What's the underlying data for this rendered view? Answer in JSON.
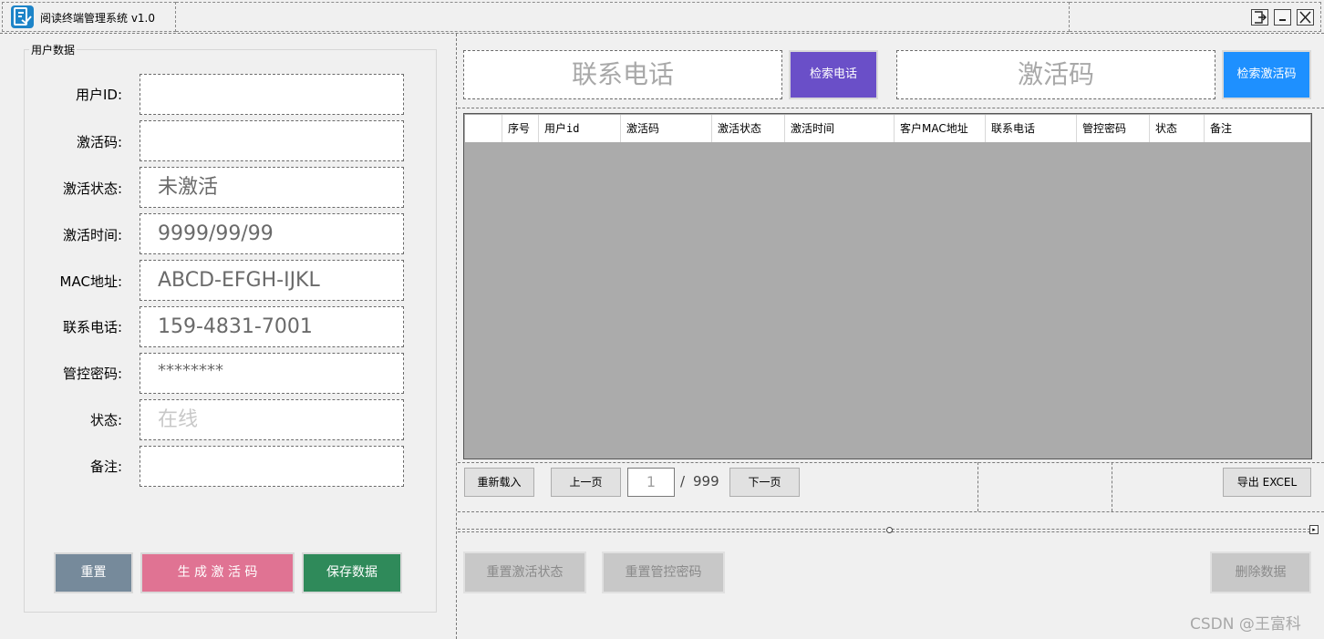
{
  "window": {
    "title": "阅读终端管理系统 v1.0",
    "controls": [
      "restore-icon",
      "minimize-icon",
      "close-icon"
    ]
  },
  "user_data": {
    "group_title": "用户数据",
    "fields": [
      {
        "label": "用户ID:",
        "value": ""
      },
      {
        "label": "激活码:",
        "value": ""
      },
      {
        "label": "激活状态:",
        "value": "未激活"
      },
      {
        "label": "激活时间:",
        "value": "9999/99/99"
      },
      {
        "label": "MAC地址:",
        "value": "ABCD-EFGH-IJKL"
      },
      {
        "label": "联系电话:",
        "value": "159-4831-7001"
      },
      {
        "label": "管控密码:",
        "value": "********"
      },
      {
        "label": "状态:",
        "value": "在线"
      },
      {
        "label": "备注:",
        "value": ""
      }
    ],
    "buttons": {
      "reset": "重置",
      "generate": "生 成 激 活 码",
      "save": "保存数据"
    }
  },
  "search": {
    "phone_placeholder": "联系电话",
    "phone_button": "检索电话",
    "code_placeholder": "激活码",
    "code_button": "检索激活码"
  },
  "table": {
    "columns": [
      "",
      "序号",
      "用户id",
      "激活码",
      "激活状态",
      "激活时间",
      "客户MAC地址",
      "联系电话",
      "管控密码",
      "状态",
      "备注"
    ],
    "rows": []
  },
  "pagination": {
    "reload": "重新载入",
    "prev": "上一页",
    "current": "1",
    "separator": "/",
    "total": "999",
    "next": "下一页",
    "export": "导出 EXCEL"
  },
  "actions": {
    "reset_activation": "重置激活状态",
    "reset_password": "重置管控密码",
    "delete": "删除数据"
  },
  "watermark": "CSDN @王富科",
  "colors": {
    "reset_btn": "#768a9b",
    "generate_btn": "#e07393",
    "save_btn": "#2f8a5a",
    "search_phone_btn": "#6a4fc8",
    "search_code_btn": "#1e90ff",
    "grid_bg": "#ababab"
  }
}
